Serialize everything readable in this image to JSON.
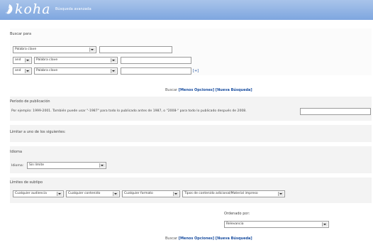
{
  "header": {
    "logo_text": "koha",
    "title": "Búsqueda avanzada"
  },
  "search_for": {
    "label": "Buscar para",
    "rows": [
      {
        "index": "Palabra clave"
      },
      {
        "operator": "and",
        "index": "Palabra clave"
      },
      {
        "operator": "and",
        "index": "Palabra clave"
      }
    ],
    "add_row": "[+]"
  },
  "actions": {
    "search": "Buscar",
    "fewer_options": "[Menos Opciones]",
    "new_search": "[Nueva Búsqueda]"
  },
  "pub_period": {
    "label": "Período de publicación",
    "hint": "Por ejemplo: 1999-2001. También puede usar \"-1987\" para todo lo publicado antes de 1987, o \"2008-\" para todo lo publicado después de 2008."
  },
  "limit_to": {
    "label": "Limitar a uno de los siguientes:"
  },
  "language": {
    "section": "Idioma",
    "label": "Idioma:",
    "value": "Sin límite"
  },
  "subtypes": {
    "label": "Límites de subtipo",
    "selects": [
      "Cualquier audiencia",
      "Cualquier contenido",
      "Cualquier formato",
      "Tipos de contenido adicional/Material impreso"
    ]
  },
  "sort": {
    "label": "Ordenado por:",
    "value": "Relevancia"
  },
  "colors": {
    "header": "#8fb2e4",
    "link": "#1a4ea0"
  }
}
